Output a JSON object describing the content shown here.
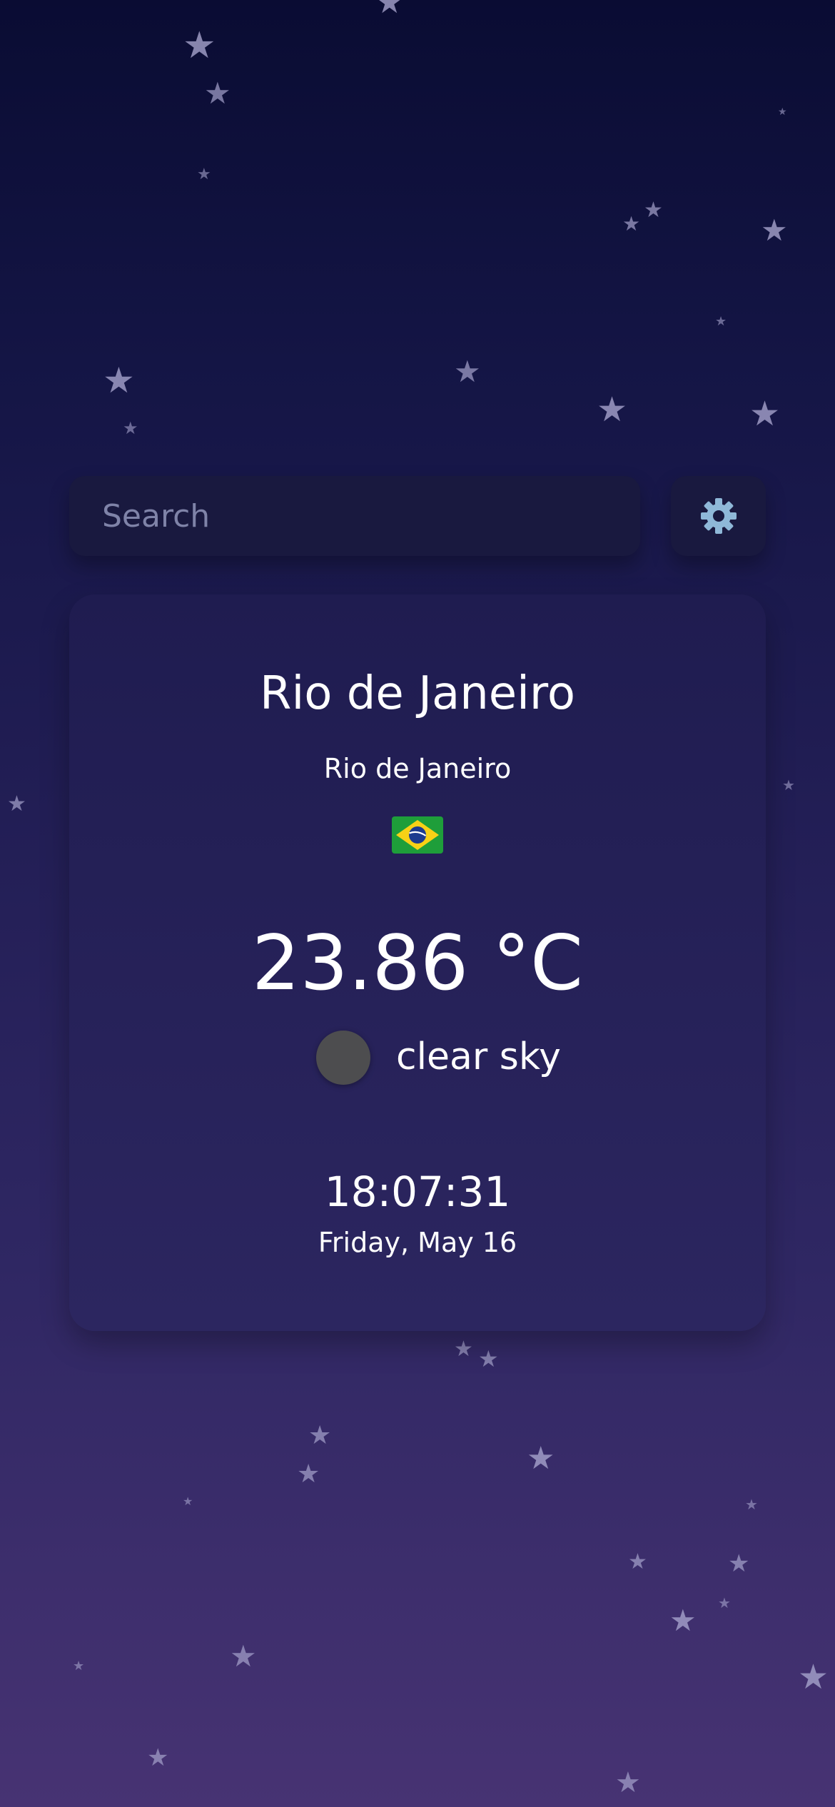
{
  "search": {
    "placeholder": "Search",
    "value": ""
  },
  "settings": {
    "icon": "gear-icon",
    "icon_color": "#8fb8d8"
  },
  "weather": {
    "city": "Rio de Janeiro",
    "region": "Rio de Janeiro",
    "country_flag": "brazil-flag-icon",
    "temperature": "23.86 °C",
    "condition": "clear sky",
    "condition_icon": "clear-sky-icon",
    "time": "18:07:31",
    "date": "Friday, May 16"
  },
  "theme": {
    "background_top": "#0a0c33",
    "background_bottom": "#473373",
    "card_color": "#221e55",
    "star_color": "#a6a3cc",
    "text_color": "#ffffff",
    "placeholder_color": "#7f83a8"
  }
}
